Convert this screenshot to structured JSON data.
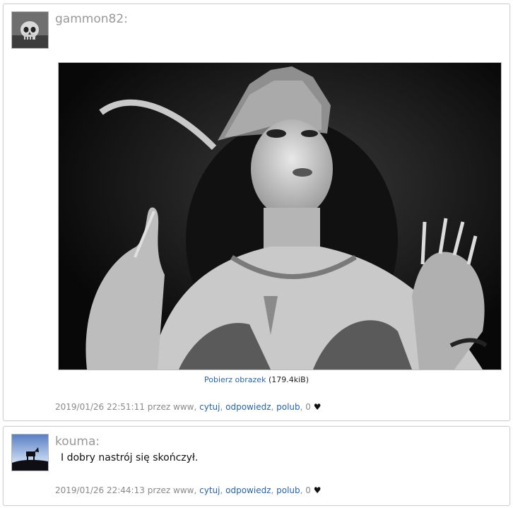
{
  "posts": [
    {
      "username": "gammon82",
      "colon": ":",
      "avatar_icon": "skull-avatar-icon",
      "image": {
        "alt": "vintage black and white photo",
        "download_label": "Pobierz obrazek",
        "size": "(179.4kiB)"
      },
      "meta": {
        "timestamp": "2019/01/26 22:51:11",
        "via": "przez www,",
        "quote": "cytuj",
        "reply": "odpowiedz",
        "like": "polub",
        "likes": "0"
      }
    },
    {
      "username": "kouma",
      "colon": ":",
      "avatar_icon": "silhouette-avatar-icon",
      "text": "I dobry nastrój się skończył.",
      "meta": {
        "timestamp": "2019/01/26 22:44:13",
        "via": "przez www,",
        "quote": "cytuj",
        "reply": "odpowiedz",
        "like": "polub",
        "likes": "0"
      }
    }
  ],
  "colors": {
    "link": "#2a64a8",
    "username": "#999999",
    "meta": "#8a8a8a"
  }
}
